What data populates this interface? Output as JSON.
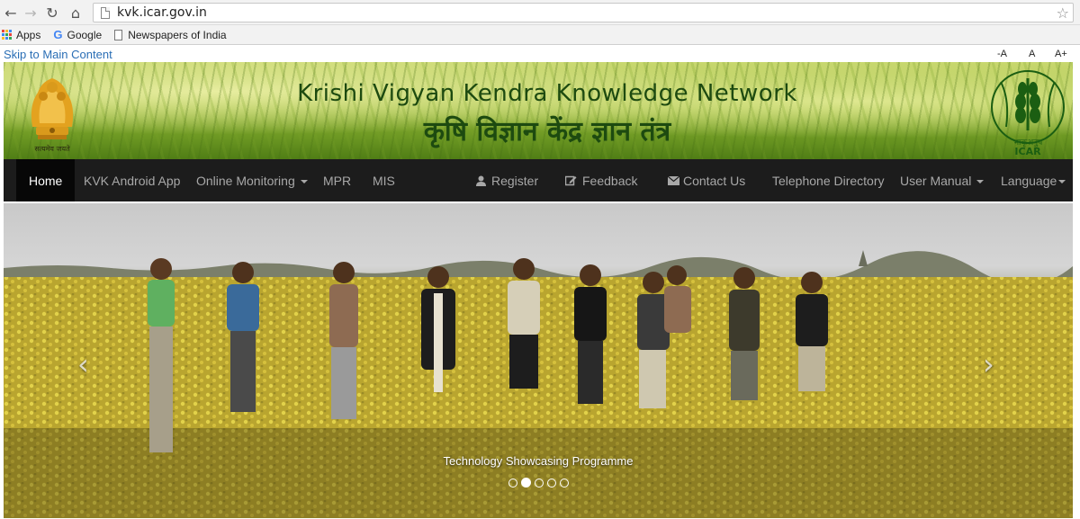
{
  "browser": {
    "url": "kvk.icar.gov.in",
    "bookmarks": [
      {
        "label": "Apps",
        "icon": "apps-grid-icon"
      },
      {
        "label": "Google",
        "icon": "google-icon"
      },
      {
        "label": "Newspapers of India",
        "icon": "page-icon"
      }
    ]
  },
  "skip_link": "Skip to Main Content",
  "font_controls": [
    "-A",
    "A",
    "A+"
  ],
  "header": {
    "title": "Krishi Vigyan Kendra Knowledge Network",
    "title_hindi": "कृषि विज्ञान केंद्र ज्ञान तंत्र",
    "emblem_caption": "सत्यमेव जयते",
    "icar_caption_hindi": "भाकृअनुप",
    "icar_caption": "ICAR"
  },
  "nav": {
    "home": "Home",
    "android_app": "KVK Android App",
    "online_monitoring": "Online Monitoring",
    "mpr": "MPR",
    "mis": "MIS",
    "register": "Register",
    "feedback": "Feedback",
    "contact": "Contact Us",
    "telephone": "Telephone Directory",
    "user_manual": "User Manual",
    "language": "Language"
  },
  "carousel": {
    "caption": "Technology Showcasing Programme",
    "slides": 5,
    "active_slide": 2
  },
  "colors": {
    "navbar": "#1c1c1c",
    "link": "#2a6eb5",
    "title_green": "#1d4a10"
  }
}
